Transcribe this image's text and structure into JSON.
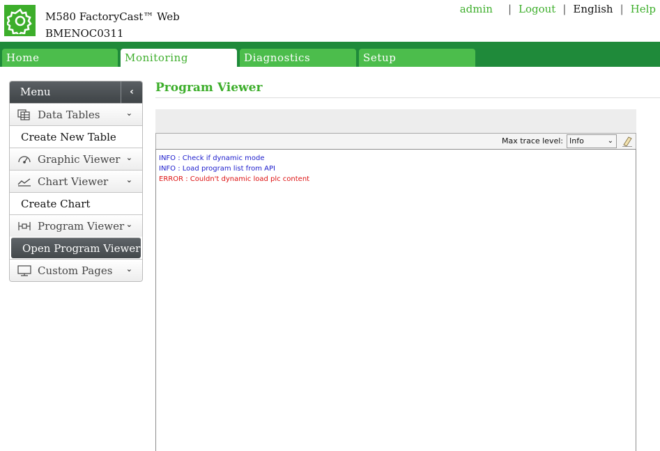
{
  "header": {
    "product": "M580 FactoryCast™ Web",
    "device": "BMENOC0311",
    "links": {
      "user": "admin",
      "logout": "Logout",
      "language": "English",
      "help": "Help",
      "separator": "|"
    }
  },
  "nav": {
    "tabs": [
      {
        "label": "Home"
      },
      {
        "label": "Monitoring"
      },
      {
        "label": "Diagnostics"
      },
      {
        "label": "Setup"
      }
    ],
    "active_tab": "Monitoring"
  },
  "sidebar": {
    "title": "Menu",
    "collapse_glyph": "‹",
    "items": [
      {
        "label": "Data Tables",
        "type": "group",
        "icon": "data-tables-icon"
      },
      {
        "label": "Create New Table",
        "type": "sub"
      },
      {
        "label": "Graphic Viewer",
        "type": "group",
        "icon": "graphic-viewer-icon"
      },
      {
        "label": "Chart Viewer",
        "type": "group",
        "icon": "chart-viewer-icon"
      },
      {
        "label": "Create Chart",
        "type": "sub"
      },
      {
        "label": "Program Viewer",
        "type": "group",
        "icon": "program-viewer-icon"
      },
      {
        "label": "Open Program Viewer",
        "type": "sub",
        "selected": true
      },
      {
        "label": "Custom Pages",
        "type": "group",
        "icon": "custom-pages-icon"
      }
    ],
    "chevron_glyph": "⌄"
  },
  "main": {
    "title": "Program Viewer",
    "trace": {
      "label": "Max trace level:",
      "value": "Info",
      "options_visible": [
        "Info"
      ]
    },
    "log": [
      {
        "level": "info",
        "text": "INFO : Check if dynamic mode"
      },
      {
        "level": "info",
        "text": "INFO : Load program list from API"
      },
      {
        "level": "error",
        "text": "ERROR : Couldn't dynamic load plc content"
      }
    ]
  },
  "colors": {
    "brand_green": "#3dae2b",
    "nav_dark_green": "#1f8a3a",
    "tab_green": "#4cbd4c",
    "menu_dark": "#44494c",
    "info_text": "#1a1acc",
    "error_text": "#dd1111"
  }
}
